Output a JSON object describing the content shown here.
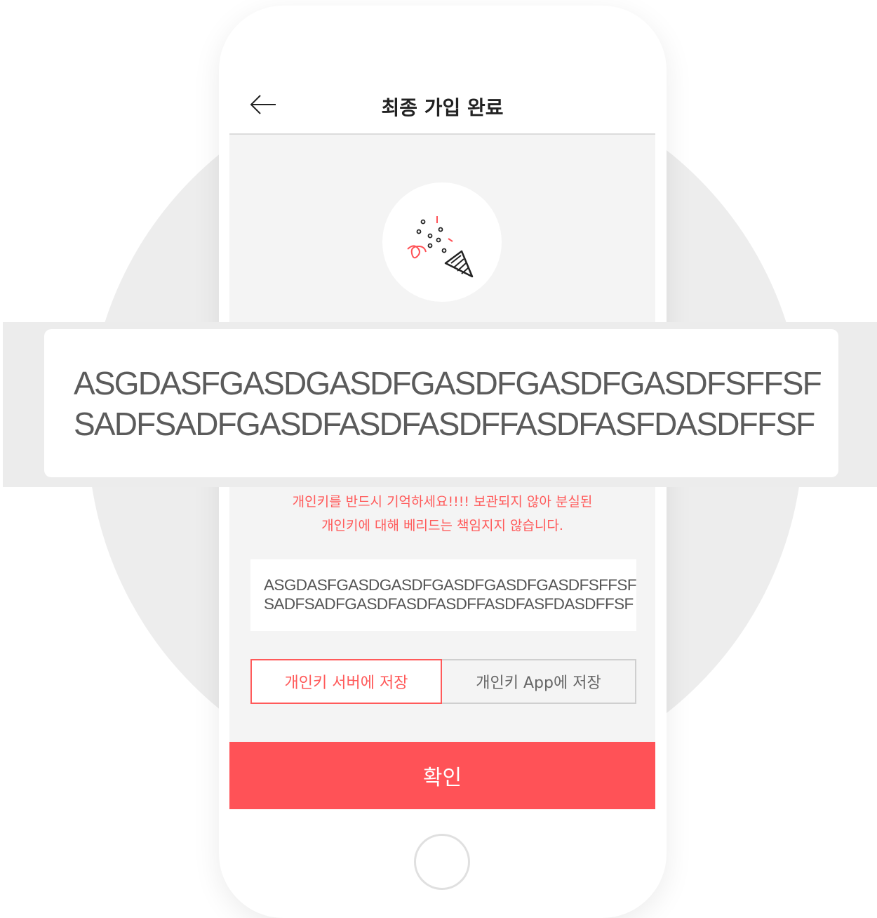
{
  "header": {
    "title": "최종 가입 완료"
  },
  "icons": {
    "back": "arrow-left-icon",
    "celebration": "party-popper-icon"
  },
  "overlay": {
    "key_line1": "ASGDASFGASDGASDFGASDFGASDFGASDFSFFSF",
    "key_line2": "SADFSADFGASDFASDFASDFFASDFASFDASDFFSF"
  },
  "warning": {
    "line1": "개인키를 반드시 기억하세요!!!! 보관되지 않아 분실된",
    "line2": "개인키에 대해 베리드는 책임지지 않습니다."
  },
  "key_box": {
    "line1": "ASGDASFGASDGASDFGASDFGASDFGASDFSFFSF",
    "line2": "SADFSADFGASDFASDFASDFFASDFASFDASDFFSF"
  },
  "save_options": [
    {
      "label": "개인키 서버에 저장",
      "selected": true
    },
    {
      "label": "개인키 App에 저장",
      "selected": false
    }
  ],
  "confirm_button": {
    "label": "확인"
  },
  "colors": {
    "accent": "#ff5257",
    "warning_text": "#ff5a5a",
    "screen_bg": "#f4f4f4"
  }
}
